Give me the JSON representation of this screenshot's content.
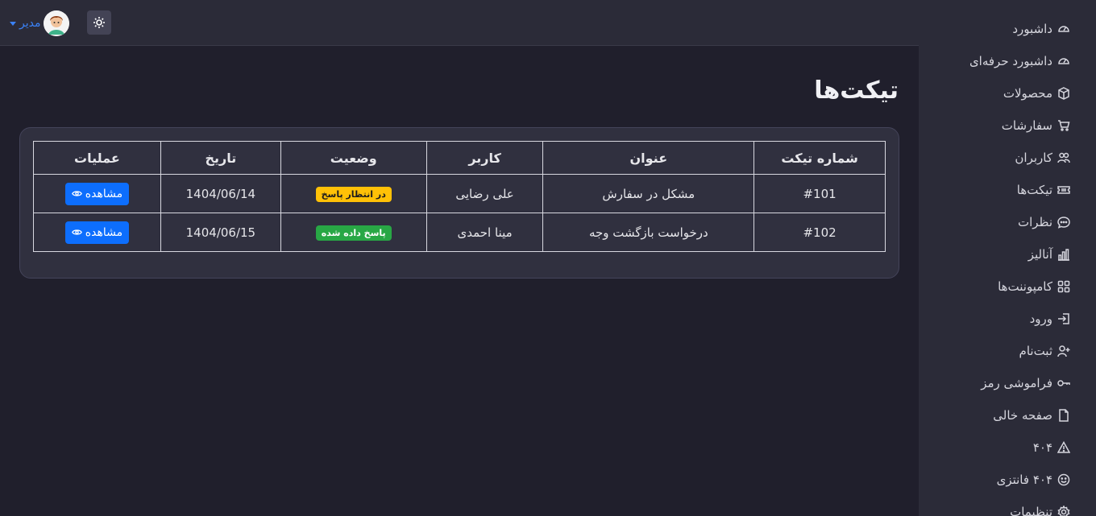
{
  "header": {
    "user_name": "مدیر",
    "theme_icon": "sun-icon"
  },
  "page": {
    "title": "تیکت‌ها"
  },
  "sidebar": {
    "items": [
      {
        "label": "داشبورد",
        "icon": "speedometer-icon"
      },
      {
        "label": "داشبورد حرفه‌ای",
        "icon": "speedometer-icon"
      },
      {
        "label": "محصولات",
        "icon": "box-icon"
      },
      {
        "label": "سفارشات",
        "icon": "cart-icon"
      },
      {
        "label": "کاربران",
        "icon": "users-icon"
      },
      {
        "label": "تیکت‌ها",
        "icon": "ticket-icon"
      },
      {
        "label": "نظرات",
        "icon": "chat-icon"
      },
      {
        "label": "آنالیز",
        "icon": "bar-chart-icon"
      },
      {
        "label": "کامپوننت‌ها",
        "icon": "grid-icon"
      },
      {
        "label": "ورود",
        "icon": "login-icon"
      },
      {
        "label": "ثبت‌نام",
        "icon": "user-plus-icon"
      },
      {
        "label": "فراموشی رمز",
        "icon": "key-icon"
      },
      {
        "label": "صفحه خالی",
        "icon": "file-icon"
      },
      {
        "label": "۴۰۴",
        "icon": "warning-icon"
      },
      {
        "label": "۴۰۴ فانتزی",
        "icon": "smile-icon"
      },
      {
        "label": "تنظیمات",
        "icon": "gear-icon"
      }
    ]
  },
  "table": {
    "columns": [
      "شماره تیکت",
      "عنوان",
      "کاربر",
      "وضعیت",
      "تاریخ",
      "عملیات"
    ],
    "rows": [
      {
        "id": "#101",
        "title": "مشکل در سفارش",
        "user": "علی رضایی",
        "status": "در انتظار پاسخ",
        "status_color": "#ffc107",
        "date": "1404/06/14",
        "action": "مشاهده"
      },
      {
        "id": "#102",
        "title": "درخواست بازگشت وجه",
        "user": "مینا احمدی",
        "status": "پاسخ داده شده",
        "status_color": "#28a745",
        "date": "1404/06/15",
        "action": "مشاهده"
      }
    ]
  },
  "colors": {
    "accent": "#0d6efd",
    "sidebar_bg": "#2b2b38",
    "content_bg": "#201f2c"
  }
}
